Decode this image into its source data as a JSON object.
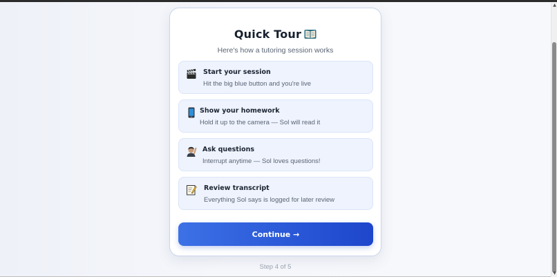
{
  "tour": {
    "title": "Quick Tour",
    "title_icon": "open-book-icon",
    "subtitle": "Here's how a tutoring session works",
    "steps": [
      {
        "icon": "clapperboard-icon",
        "title": "Start your session",
        "description": "Hit the big blue button and you're live"
      },
      {
        "icon": "mobile-phone-icon",
        "title": "Show your homework",
        "description": "Hold it up to the camera — Sol will read it"
      },
      {
        "icon": "person-raising-hand-icon",
        "title": "Ask questions",
        "description": "Interrupt anytime — Sol loves questions!"
      },
      {
        "icon": "memo-icon",
        "title": "Review transcript",
        "description": "Everything Sol says is logged for later review"
      }
    ],
    "continue_label": "Continue →",
    "step_indicator": "Step 4 of 5"
  },
  "colors": {
    "accent": "#2c5bd9",
    "card_item_bg": "#eef3fd",
    "title_text": "#16202e",
    "muted_text": "#9aa1ad"
  }
}
